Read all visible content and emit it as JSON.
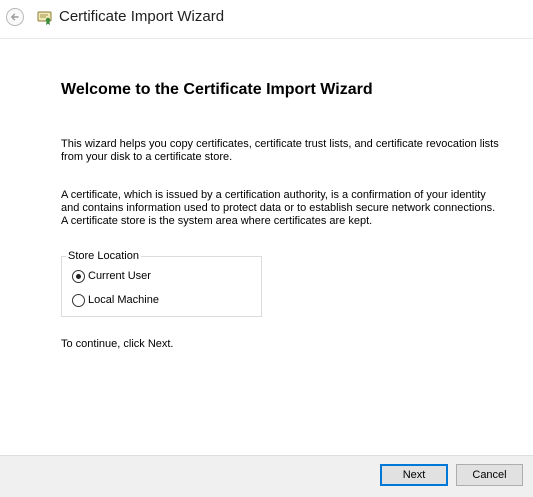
{
  "window": {
    "title": "Certificate Import Wizard",
    "back_icon": "back-arrow-icon",
    "app_icon": "certificate-icon"
  },
  "content": {
    "heading": "Welcome to the Certificate Import Wizard",
    "paragraph1": "This wizard helps you copy certificates, certificate trust lists, and certificate revocation lists from your disk to a certificate store.",
    "paragraph2": "A certificate, which is issued by a certification authority, is a confirmation of your identity and contains information used to protect data or to establish secure network connections. A certificate store is the system area where certificates are kept.",
    "store_location": {
      "legend": "Store Location",
      "options": [
        {
          "label": "Current User",
          "selected": true
        },
        {
          "label": "Local Machine",
          "selected": false
        }
      ]
    },
    "continue_text": "To continue, click Next."
  },
  "footer": {
    "next_label": "Next",
    "cancel_label": "Cancel"
  },
  "colors": {
    "accent": "#0078d7",
    "footer_bg": "#f0f0f0"
  }
}
